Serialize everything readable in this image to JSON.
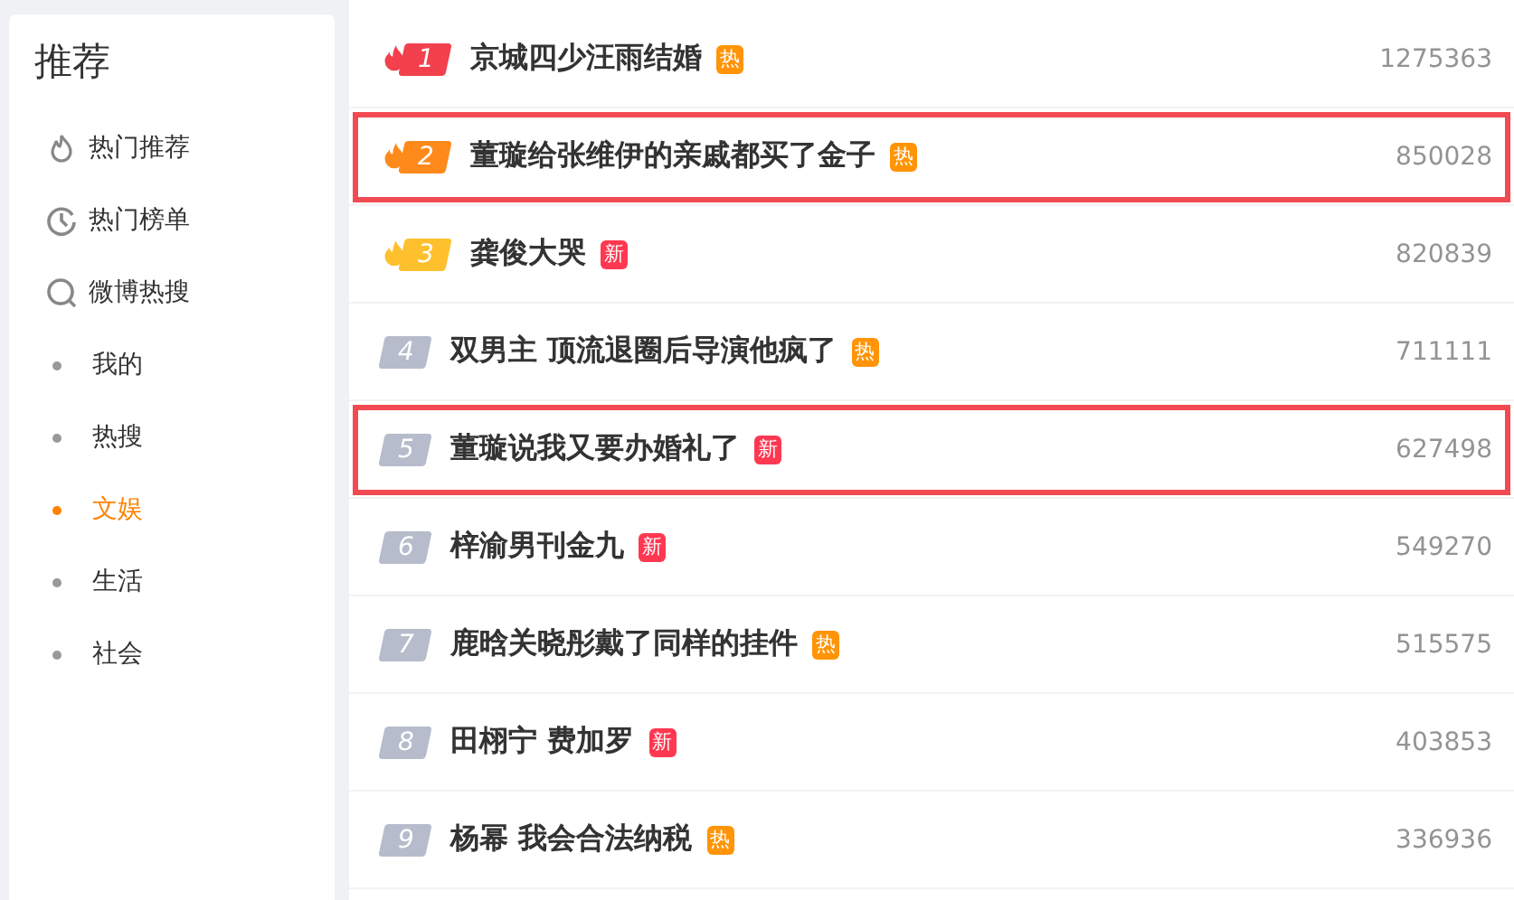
{
  "sidebar": {
    "title": "推荐",
    "items": [
      {
        "label": "热门推荐",
        "kind": "flame",
        "selected": false
      },
      {
        "label": "热门榜单",
        "kind": "clock",
        "selected": false
      },
      {
        "label": "微博热搜",
        "kind": "search",
        "selected": false
      },
      {
        "label": "我的",
        "kind": "dot",
        "selected": false
      },
      {
        "label": "热搜",
        "kind": "dot",
        "selected": false
      },
      {
        "label": "文娱",
        "kind": "dot",
        "selected": true
      },
      {
        "label": "生活",
        "kind": "dot",
        "selected": false
      },
      {
        "label": "社会",
        "kind": "dot",
        "selected": false
      }
    ]
  },
  "hot_list": [
    {
      "rank": "1",
      "kind": "flame",
      "color": "#f2414d",
      "title": "京城四少汪雨结婚",
      "badge": {
        "kind": "hot",
        "text": "热"
      },
      "count": "1275363",
      "highlighted": false
    },
    {
      "rank": "2",
      "kind": "flame",
      "color": "#ff8a1c",
      "title": "董璇给张维伊的亲戚都买了金子",
      "badge": {
        "kind": "hot",
        "text": "热"
      },
      "count": "850028",
      "highlighted": true
    },
    {
      "rank": "3",
      "kind": "flame",
      "color": "#ffc02e",
      "title": "龚俊大哭",
      "badge": {
        "kind": "new",
        "text": "新"
      },
      "count": "820839",
      "highlighted": false
    },
    {
      "rank": "4",
      "kind": "plain",
      "color": "#b6bccb",
      "title": "双男主 顶流退圈后导演他疯了",
      "badge": {
        "kind": "hot",
        "text": "热"
      },
      "count": "711111",
      "highlighted": false
    },
    {
      "rank": "5",
      "kind": "plain",
      "color": "#b6bccb",
      "title": "董璇说我又要办婚礼了",
      "badge": {
        "kind": "new",
        "text": "新"
      },
      "count": "627498",
      "highlighted": true
    },
    {
      "rank": "6",
      "kind": "plain",
      "color": "#b6bccb",
      "title": "梓渝男刊金九",
      "badge": {
        "kind": "new",
        "text": "新"
      },
      "count": "549270",
      "highlighted": false
    },
    {
      "rank": "7",
      "kind": "plain",
      "color": "#b6bccb",
      "title": "鹿晗关晓彤戴了同样的挂件",
      "badge": {
        "kind": "hot",
        "text": "热"
      },
      "count": "515575",
      "highlighted": false
    },
    {
      "rank": "8",
      "kind": "plain",
      "color": "#b6bccb",
      "title": "田栩宁 费加罗",
      "badge": {
        "kind": "new",
        "text": "新"
      },
      "count": "403853",
      "highlighted": false
    },
    {
      "rank": "9",
      "kind": "plain",
      "color": "#b6bccb",
      "title": "杨幂 我会合法纳税",
      "badge": {
        "kind": "hot",
        "text": "热"
      },
      "count": "336936",
      "highlighted": false
    }
  ]
}
